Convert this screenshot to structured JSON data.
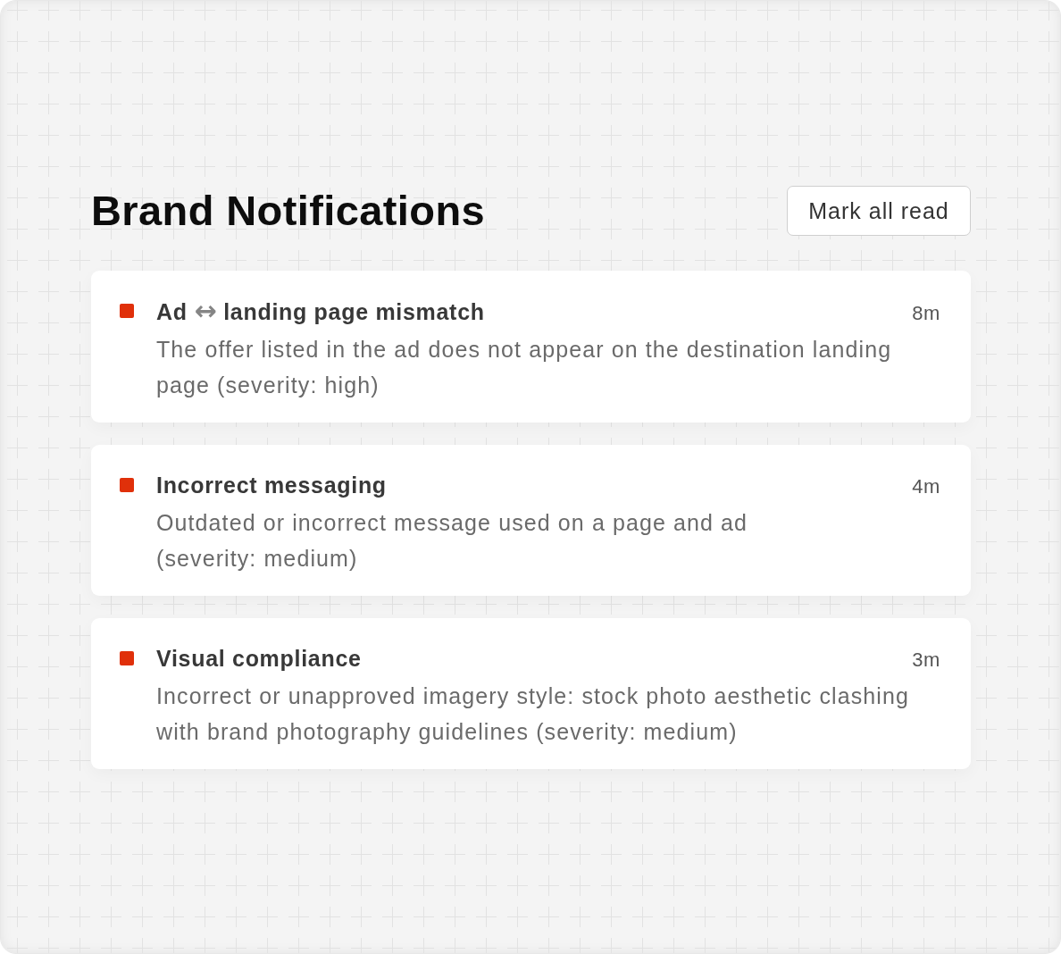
{
  "header": {
    "title": "Brand Notifications",
    "action": {
      "label": "Mark all read"
    }
  },
  "notifications": [
    {
      "unread": true,
      "title": [
        {
          "kind": "text",
          "text": "Ad"
        },
        {
          "kind": "symbol",
          "text": "↔"
        },
        {
          "kind": "text",
          "text": "landing page mismatch"
        }
      ],
      "time": "8m",
      "description": "The offer listed in the ad does not appear on the destination landing page (severity: high)"
    },
    {
      "unread": true,
      "title": [
        {
          "kind": "text",
          "text": "Incorrect messaging"
        }
      ],
      "time": "4m",
      "description": "Outdated or incorrect message used on a page and ad (severity: medium)"
    },
    {
      "unread": true,
      "title": [
        {
          "kind": "text",
          "text": "Visual compliance"
        }
      ],
      "time": "3m",
      "description": "Incorrect or unapproved imagery style: stock photo aesthetic clashing with brand photography guidelines (severity: medium)"
    }
  ]
}
